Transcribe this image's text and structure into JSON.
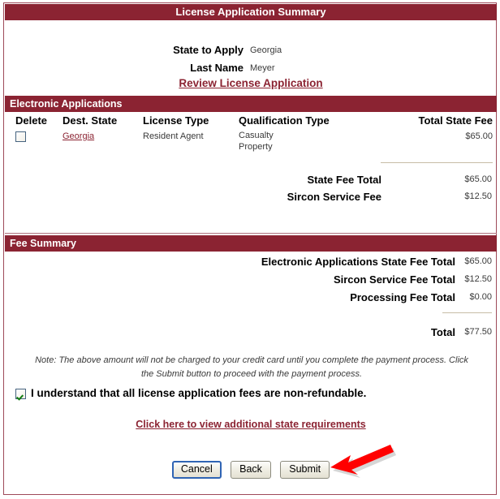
{
  "window": {
    "title": "License Application Summary"
  },
  "colors": {
    "brand_maroon": "#8b2332",
    "link": "#8b2332",
    "arrow": "#ff0000",
    "border": "#9e4a5a"
  },
  "header_fields": [
    {
      "label": "State to Apply",
      "value": "Georgia"
    },
    {
      "label": "Last Name",
      "value": "Meyer"
    }
  ],
  "review_link": "Review License Application",
  "electronic_applications": {
    "section_title": "Electronic Applications",
    "columns": [
      "Delete",
      "Dest. State",
      "License Type",
      "Qualification Type",
      "Total State Fee"
    ],
    "rows": [
      {
        "delete_checked": false,
        "dest_state": "Georgia",
        "license_type": "Resident Agent",
        "qualification_types": [
          "Casualty",
          "Property"
        ],
        "total_state_fee": "$65.00"
      }
    ],
    "totals": [
      {
        "label": "State Fee Total",
        "value": "$65.00"
      },
      {
        "label": "Sircon Service Fee",
        "value": "$12.50"
      }
    ]
  },
  "fee_summary": {
    "section_title": "Fee Summary",
    "rows": [
      {
        "label": "Electronic Applications State Fee Total",
        "value": "$65.00"
      },
      {
        "label": "Sircon Service Fee Total",
        "value": "$12.50"
      },
      {
        "label": "Processing Fee Total",
        "value": "$0.00"
      }
    ],
    "total": {
      "label": "Total",
      "value": "$77.50"
    }
  },
  "note": "Note: The above amount will not be charged to your credit card until you complete the payment process. Click the Submit button to proceed with the payment process.",
  "acknowledgement": {
    "checked": true,
    "label": "I understand that all license application fees are non-refundable."
  },
  "additional_requirements_link": "Click here to view additional state requirements",
  "buttons": {
    "cancel": "Cancel",
    "back": "Back",
    "submit": "Submit"
  },
  "annotation": {
    "arrow": "red-arrow-pointing-at-submit"
  }
}
